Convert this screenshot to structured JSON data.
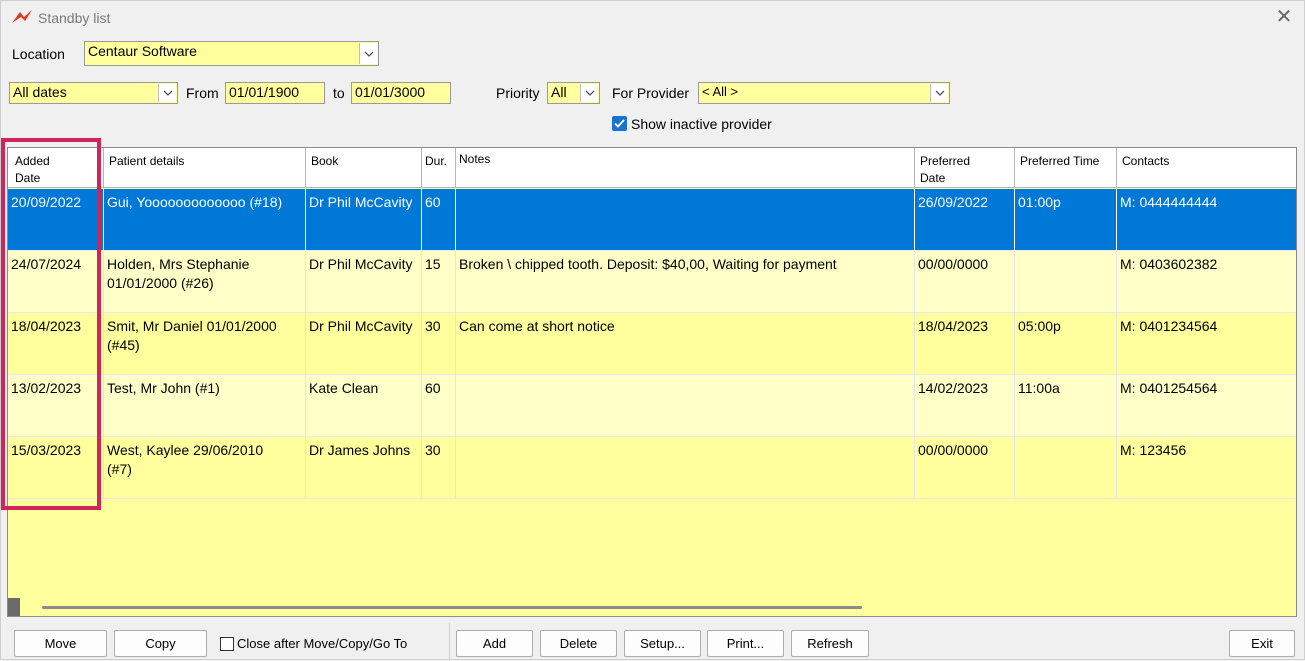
{
  "window": {
    "title": "Standby list"
  },
  "filters": {
    "location_label": "Location",
    "location_value": "Centaur Software",
    "dates_value": "All dates",
    "from_label": "From",
    "from_value": "01/01/1900",
    "to_label": "to",
    "to_value": "01/01/3000",
    "priority_label": "Priority",
    "priority_value": "All",
    "provider_label": "For Provider",
    "provider_value": "< All >",
    "show_inactive_label": "Show inactive provider"
  },
  "table": {
    "headers": [
      "Added\nDate",
      "Patient details",
      "Book",
      "Dur.",
      "Notes",
      "Preferred\nDate",
      "Preferred Time",
      "Contacts"
    ],
    "rows": [
      {
        "added": "20/09/2022",
        "patient": "Gui, Yooooooooooooo (#18)",
        "book": "Dr Phil McCavity",
        "dur": "60",
        "notes": "",
        "pref_date": "26/09/2022",
        "pref_time": "01:00p",
        "contacts": "M: 0444444444"
      },
      {
        "added": "24/07/2024",
        "patient": "Holden, Mrs Stephanie\n01/01/2000 (#26)",
        "book": "Dr Phil McCavity",
        "dur": "15",
        "notes": "Broken \\ chipped tooth.  Deposit: $40,00, Waiting for payment",
        "pref_date": "00/00/0000",
        "pref_time": "",
        "contacts": "M: 0403602382"
      },
      {
        "added": "18/04/2023",
        "patient": "Smit, Mr Daniel 01/01/2000\n(#45)",
        "book": "Dr Phil McCavity",
        "dur": "30",
        "notes": "Can come at short notice",
        "pref_date": "18/04/2023",
        "pref_time": "05:00p",
        "contacts": "M: 0401234564"
      },
      {
        "added": "13/02/2023",
        "patient": "Test, Mr John (#1)",
        "book": "Kate Clean",
        "dur": "60",
        "notes": "",
        "pref_date": "14/02/2023",
        "pref_time": "11:00a",
        "contacts": "M: 0401254564"
      },
      {
        "added": "15/03/2023",
        "patient": "West, Kaylee 29/06/2010\n(#7)",
        "book": "Dr James Johns",
        "dur": "30",
        "notes": "",
        "pref_date": "00/00/0000",
        "pref_time": "",
        "contacts": "M: 123456"
      }
    ]
  },
  "buttons": {
    "move": "Move",
    "copy": "Copy",
    "close_after": "Close after Move/Copy/Go To",
    "add": "Add",
    "delete": "Delete",
    "setup": "Setup...",
    "print": "Print...",
    "refresh": "Refresh",
    "exit": "Exit"
  },
  "colors": {
    "field_yellow": "#ffff9e",
    "row_light": "#ffffc8",
    "selection_blue": "#0078d7",
    "highlight_red": "#d0245a"
  }
}
